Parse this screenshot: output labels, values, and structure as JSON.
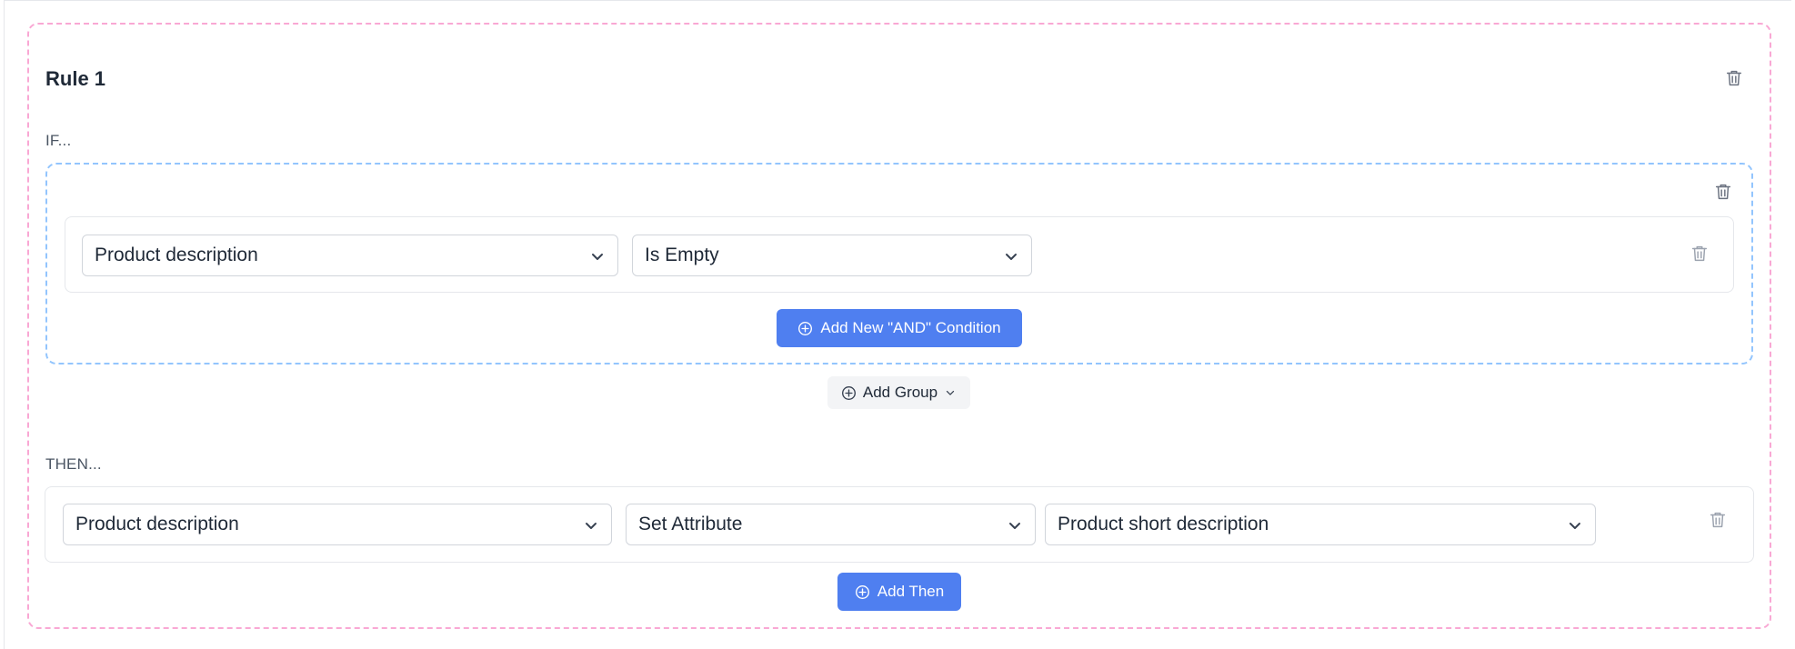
{
  "rule": {
    "title": "Rule 1",
    "if_label": "IF...",
    "then_label": "THEN..."
  },
  "conditions": [
    {
      "attribute": "Product description",
      "operator": "Is Empty"
    }
  ],
  "buttons": {
    "add_and_condition": "Add New \"AND\" Condition",
    "add_group": "Add Group",
    "add_then": "Add Then"
  },
  "actions": [
    {
      "attribute": "Product description",
      "action": "Set Attribute",
      "value": "Product short description"
    }
  ],
  "colors": {
    "primary": "#4f7ff0",
    "rule_border": "#f9a8d4",
    "group_border": "#93c5fd"
  },
  "icons": [
    "trash-icon",
    "chevron-down-icon",
    "plus-circle-icon"
  ]
}
